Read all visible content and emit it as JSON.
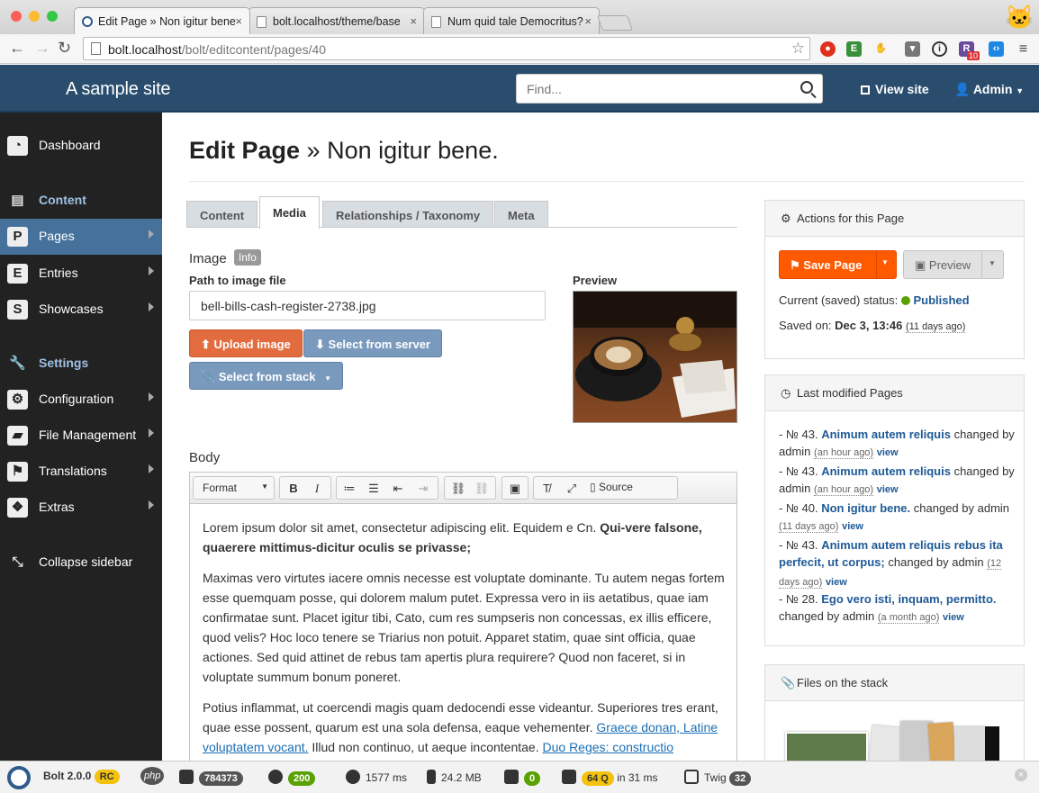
{
  "browser": {
    "tabs": [
      {
        "title": "Edit Page » Non igitur bene"
      },
      {
        "title": "bolt.localhost/theme/base"
      },
      {
        "title": "Num quid tale Democritus?"
      }
    ],
    "url_host": "bolt.localhost",
    "url_path": "/bolt/editcontent/pages/40",
    "extension_badge": "10"
  },
  "header": {
    "site_name": "A sample site",
    "search_placeholder": "Find...",
    "view_site": "View site",
    "admin": "Admin"
  },
  "sidebar": {
    "dashboard": "Dashboard",
    "content": "Content",
    "pages": "Pages",
    "entries": "Entries",
    "showcases": "Showcases",
    "settings": "Settings",
    "configuration": "Configuration",
    "file_management": "File Management",
    "translations": "Translations",
    "extras": "Extras",
    "collapse": "Collapse sidebar"
  },
  "page": {
    "title_prefix": "Edit Page",
    "title_sep": "»",
    "title_name": "Non igitur bene.",
    "tabs": [
      "Content",
      "Media",
      "Relationships / Taxonomy",
      "Meta"
    ]
  },
  "image_field": {
    "label": "Image",
    "info": "Info",
    "path_label": "Path to image file",
    "path_value": "bell-bills-cash-register-2738.jpg",
    "preview_label": "Preview",
    "upload": "Upload image",
    "select_server": "Select from server",
    "select_stack": "Select from stack"
  },
  "body_field": {
    "label": "Body",
    "format": "Format",
    "source": "Source",
    "p1_text": "Lorem ipsum dolor sit amet, consectetur adipiscing elit. Equidem e Cn. ",
    "p1_bold": "Qui-vere falsone, quaerere mittimus-dicitur oculis se privasse;",
    "p2": "Maximas vero virtutes iacere omnis necesse est voluptate dominante. Tu autem negas fortem esse quemquam posse, qui dolorem malum putet. Expressa vero in iis aetatibus, quae iam confirmatae sunt. Placet igitur tibi, Cato, cum res sumpseris non concessas, ex illis efficere, quod velis? Hoc loco tenere se Triarius non potuit. Apparet statim, quae sint officia, quae actiones. Sed quid attinet de rebus tam apertis plura requirere? Quod non faceret, si in voluptate summum bonum poneret.",
    "p3_text": "Potius inflammat, ut coercendi magis quam dedocendi esse videantur. Superiores tres erant, quae esse possent, quarum est una sola defensa, eaque vehementer. ",
    "p3_link1": "Graece donan, Latine voluptatem vocant.",
    "p3_text2": " Illud non continuo, ut aeque incontentae. ",
    "p3_link2": "Duo Reges: constructio"
  },
  "actions_panel": {
    "title": "Actions for this Page",
    "save": "Save Page",
    "preview": "Preview",
    "status_label": "Current (saved) status:",
    "status_value": "Published",
    "saved_label": "Saved on:",
    "saved_value": "Dec 3, 13:46",
    "saved_ago": "(11 days ago)",
    "status_color": "#59a100"
  },
  "last_modified": {
    "title": "Last modified Pages",
    "items": [
      {
        "no": "- № 43.",
        "title": "Animum autem reliquis",
        "changed": "changed by admin",
        "ago": "(an hour ago)",
        "view": "view"
      },
      {
        "no": "- № 43.",
        "title": "Animum autem reliquis",
        "changed": "changed by admin",
        "ago": "(an hour ago)",
        "view": "view"
      },
      {
        "no": "- № 40.",
        "title": "Non igitur bene.",
        "changed": "changed by admin",
        "ago": "(11 days ago)",
        "view": "view"
      },
      {
        "no": "- № 43.",
        "title": "Animum autem reliquis rebus ita perfecit, ut corpus;",
        "changed": "changed by admin",
        "ago": "(12 days ago)",
        "view": "view"
      },
      {
        "no": "- № 28.",
        "title": "Ego vero isti, inquam, permitto.",
        "changed": "changed by admin",
        "ago": "(a month ago)",
        "view": "view"
      }
    ]
  },
  "stack_panel": {
    "title": "Files on the stack"
  },
  "debugbar": {
    "version": "Bolt 2.0.0",
    "rc": "RC",
    "php": "php",
    "requests": "784373",
    "config": "200",
    "time": "1577 ms",
    "memory": "24.2 MB",
    "messages": "0",
    "queries": "64 Q",
    "queries_time": "in 31 ms",
    "twig": "Twig",
    "twig_count": "32"
  },
  "colors": {
    "accent": "#2a4d6e",
    "orange": "#e36c3e",
    "save": "#ff5a00",
    "link": "#1f5a96"
  }
}
